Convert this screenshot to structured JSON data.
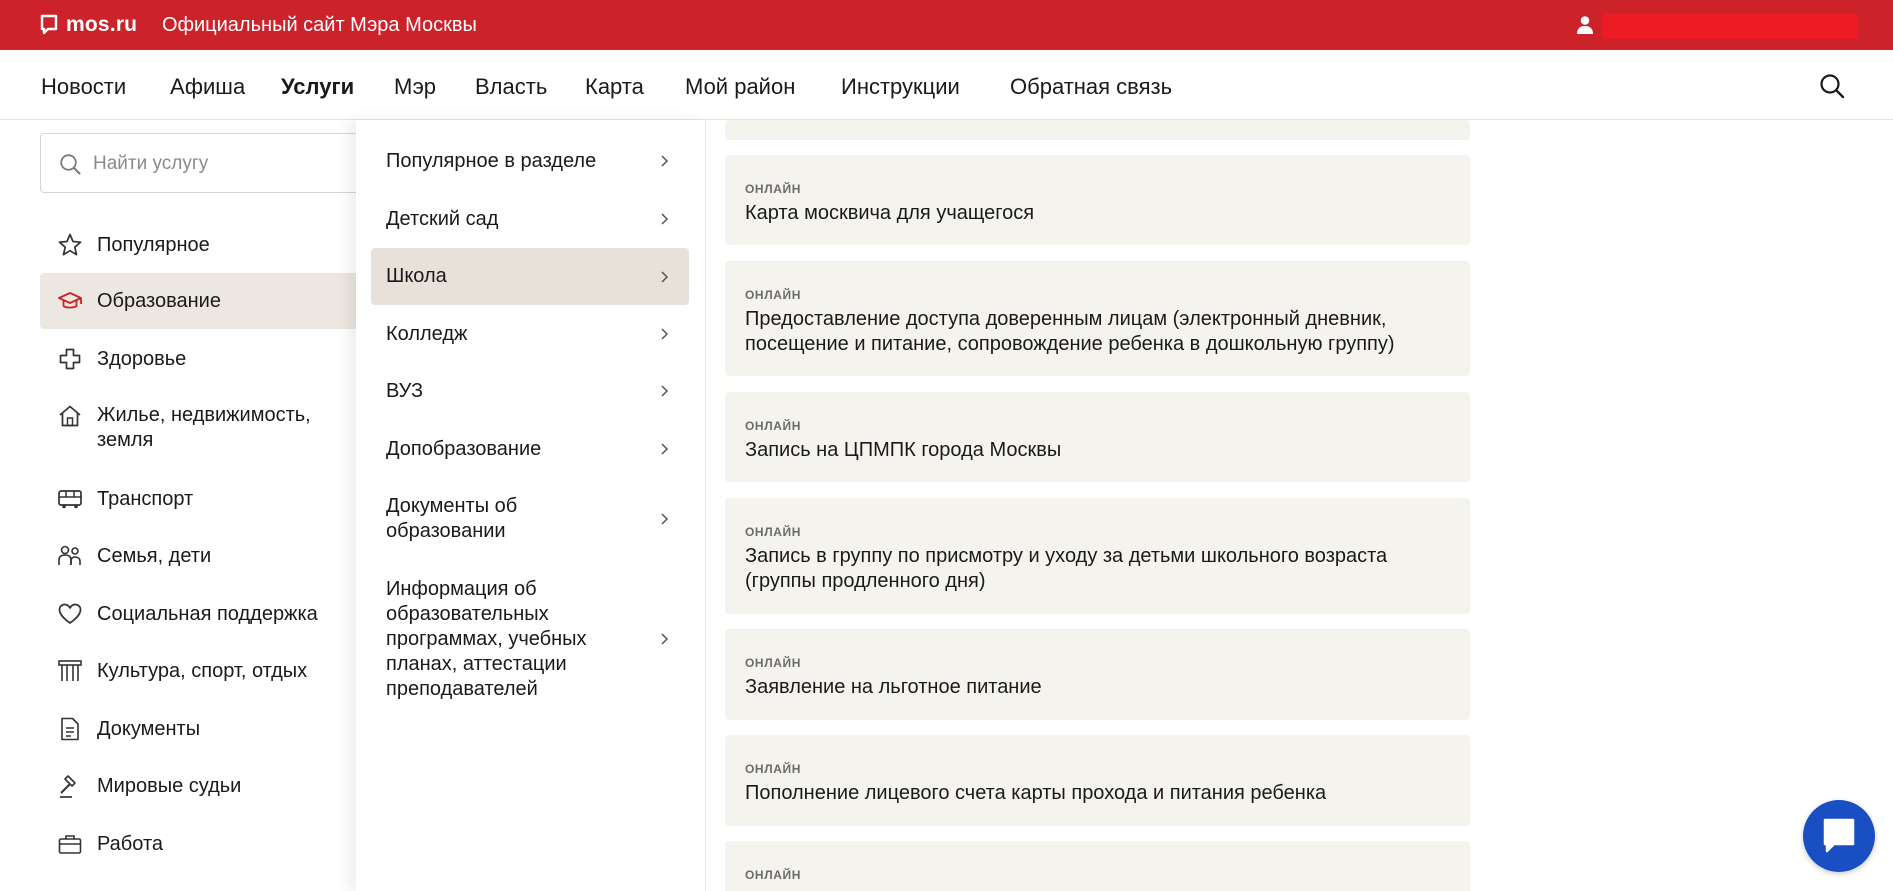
{
  "header": {
    "logo_text": "mos.ru",
    "site_title": "Официальный сайт Мэра Москвы",
    "user_name": "",
    "brand_color": "#cc2229"
  },
  "nav": {
    "items": [
      "Новости",
      "Афиша",
      "Услуги",
      "Мэр",
      "Власть",
      "Карта",
      "Мой район",
      "Инструкции",
      "Обратная связь"
    ],
    "active": "Услуги"
  },
  "search": {
    "placeholder": "Найти услугу",
    "value": ""
  },
  "categories": [
    {
      "label": "Популярное",
      "icon": "star-icon"
    },
    {
      "label": "Образование",
      "icon": "graduation-cap-icon",
      "active": true
    },
    {
      "label": "Здоровье",
      "icon": "medical-cross-icon"
    },
    {
      "label": "Жилье, недвижимость, земля",
      "icon": "home-icon"
    },
    {
      "label": "Транспорт",
      "icon": "bus-icon"
    },
    {
      "label": "Семья, дети",
      "icon": "family-icon"
    },
    {
      "label": "Социальная поддержка",
      "icon": "heart-icon"
    },
    {
      "label": "Культура, спорт, отдых",
      "icon": "theater-icon"
    },
    {
      "label": "Документы",
      "icon": "document-icon"
    },
    {
      "label": "Мировые судьи",
      "icon": "gavel-icon"
    },
    {
      "label": "Работа",
      "icon": "briefcase-icon"
    }
  ],
  "subcategories": [
    {
      "label": "Популярное в разделе"
    },
    {
      "label": "Детский сад"
    },
    {
      "label": "Школа",
      "active": true
    },
    {
      "label": "Колледж"
    },
    {
      "label": "ВУЗ"
    },
    {
      "label": "Допобразование"
    },
    {
      "label": "Документы об образовании"
    },
    {
      "label": "Информация об образовательных программах, учебных планах, аттестации преподавателей"
    }
  ],
  "services": [
    {
      "tag": "",
      "title": ""
    },
    {
      "tag": "ОНЛАЙН",
      "title": "Карта москвича для учащегося"
    },
    {
      "tag": "ОНЛАЙН",
      "title": "Предоставление доступа доверенным лицам (электронный дневник, посещение и питание, сопровождение ребенка в дошкольную группу)"
    },
    {
      "tag": "ОНЛАЙН",
      "title": "Запись на ЦПМПК города Москвы"
    },
    {
      "tag": "ОНЛАЙН",
      "title": "Запись в группу по присмотру и уходу за детьми школьного возраста (группы продленного дня)"
    },
    {
      "tag": "ОНЛАЙН",
      "title": "Заявление на льготное питание"
    },
    {
      "tag": "ОНЛАЙН",
      "title": "Пополнение лицевого счета карты прохода и питания ребенка"
    },
    {
      "tag": "ОНЛАЙН",
      "title": ""
    }
  ],
  "chat": {
    "icon": "chat-icon",
    "color": "#1a4fc4"
  }
}
